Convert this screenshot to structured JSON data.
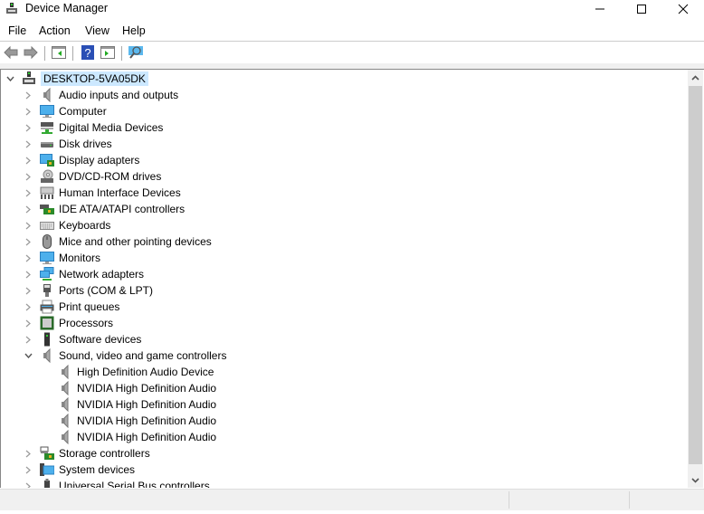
{
  "window": {
    "title": "Device Manager",
    "controls": [
      "minimize",
      "maximize",
      "close"
    ]
  },
  "menu": [
    "File",
    "Action",
    "View",
    "Help"
  ],
  "toolbar": {
    "buttons": [
      "back",
      "forward",
      "show-hide-console-tree",
      "help",
      "show-action-pane",
      "scan-for-hardware-changes"
    ]
  },
  "tree": {
    "root": "DESKTOP-5VA05DK",
    "categories": [
      {
        "label": "Audio inputs and outputs",
        "icon": "speaker-icon",
        "expanded": false
      },
      {
        "label": "Computer",
        "icon": "computer-icon",
        "expanded": false
      },
      {
        "label": "Digital Media Devices",
        "icon": "media-device-icon",
        "expanded": false
      },
      {
        "label": "Disk drives",
        "icon": "disk-drive-icon",
        "expanded": false
      },
      {
        "label": "Display adapters",
        "icon": "display-adapter-icon",
        "expanded": false
      },
      {
        "label": "DVD/CD-ROM drives",
        "icon": "dvd-drive-icon",
        "expanded": false
      },
      {
        "label": "Human Interface Devices",
        "icon": "hid-icon",
        "expanded": false
      },
      {
        "label": "IDE ATA/ATAPI controllers",
        "icon": "ide-controller-icon",
        "expanded": false
      },
      {
        "label": "Keyboards",
        "icon": "keyboard-icon",
        "expanded": false
      },
      {
        "label": "Mice and other pointing devices",
        "icon": "mouse-icon",
        "expanded": false
      },
      {
        "label": "Monitors",
        "icon": "monitor-icon",
        "expanded": false
      },
      {
        "label": "Network adapters",
        "icon": "network-adapter-icon",
        "expanded": false
      },
      {
        "label": "Ports (COM & LPT)",
        "icon": "port-icon",
        "expanded": false
      },
      {
        "label": "Print queues",
        "icon": "printer-icon",
        "expanded": false
      },
      {
        "label": "Processors",
        "icon": "processor-icon",
        "expanded": false
      },
      {
        "label": "Software devices",
        "icon": "software-device-icon",
        "expanded": false
      },
      {
        "label": "Sound, video and game controllers",
        "icon": "speaker-icon",
        "expanded": true,
        "children": [
          "High Definition Audio Device",
          "NVIDIA High Definition Audio",
          "NVIDIA High Definition Audio",
          "NVIDIA High Definition Audio",
          "NVIDIA High Definition Audio"
        ]
      },
      {
        "label": "Storage controllers",
        "icon": "storage-controller-icon",
        "expanded": false
      },
      {
        "label": "System devices",
        "icon": "system-device-icon",
        "expanded": false
      },
      {
        "label": "Universal Serial Bus controllers",
        "icon": "usb-icon",
        "expanded": false
      }
    ]
  },
  "colors": {
    "selection": "#cce8ff",
    "scroll_thumb": "#cdcdcd",
    "chrome": "#f0f0f0"
  }
}
